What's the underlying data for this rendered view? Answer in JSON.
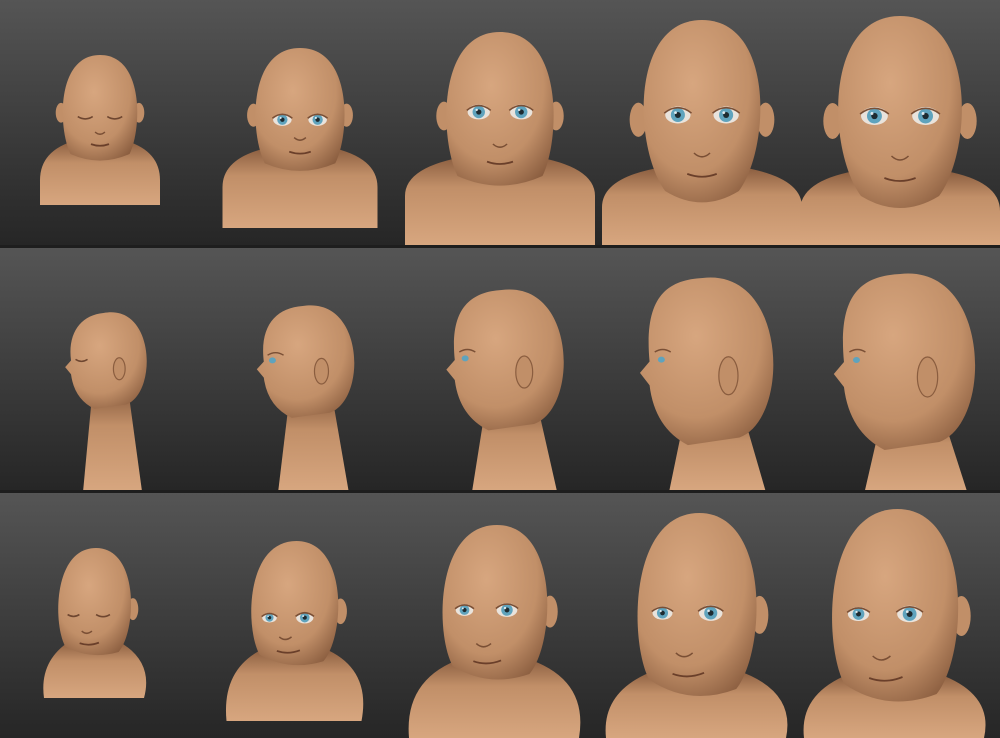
{
  "scene": {
    "palette": {
      "skin_light": "#d7a67f",
      "skin_mid": "#c18f68",
      "skin_dark": "#8a5d3f",
      "iris": "#5fa3bd",
      "bg_top": "#555555",
      "bg_bottom": "#262626"
    },
    "views": [
      {
        "name": "front",
        "heads": [
          {
            "stage": "newborn",
            "eyes": "closed"
          },
          {
            "stage": "infant",
            "eyes": "open"
          },
          {
            "stage": "child",
            "eyes": "open"
          },
          {
            "stage": "teen",
            "eyes": "open"
          },
          {
            "stage": "adult",
            "eyes": "open"
          }
        ]
      },
      {
        "name": "profile",
        "heads": [
          {
            "stage": "newborn",
            "eyes": "closed"
          },
          {
            "stage": "infant",
            "eyes": "open"
          },
          {
            "stage": "child",
            "eyes": "open"
          },
          {
            "stage": "teen",
            "eyes": "open"
          },
          {
            "stage": "adult",
            "eyes": "open"
          }
        ]
      },
      {
        "name": "three-quarter",
        "heads": [
          {
            "stage": "newborn",
            "eyes": "closed"
          },
          {
            "stage": "infant",
            "eyes": "open"
          },
          {
            "stage": "child",
            "eyes": "open"
          },
          {
            "stage": "teen",
            "eyes": "open"
          },
          {
            "stage": "adult",
            "eyes": "open"
          }
        ]
      }
    ]
  }
}
